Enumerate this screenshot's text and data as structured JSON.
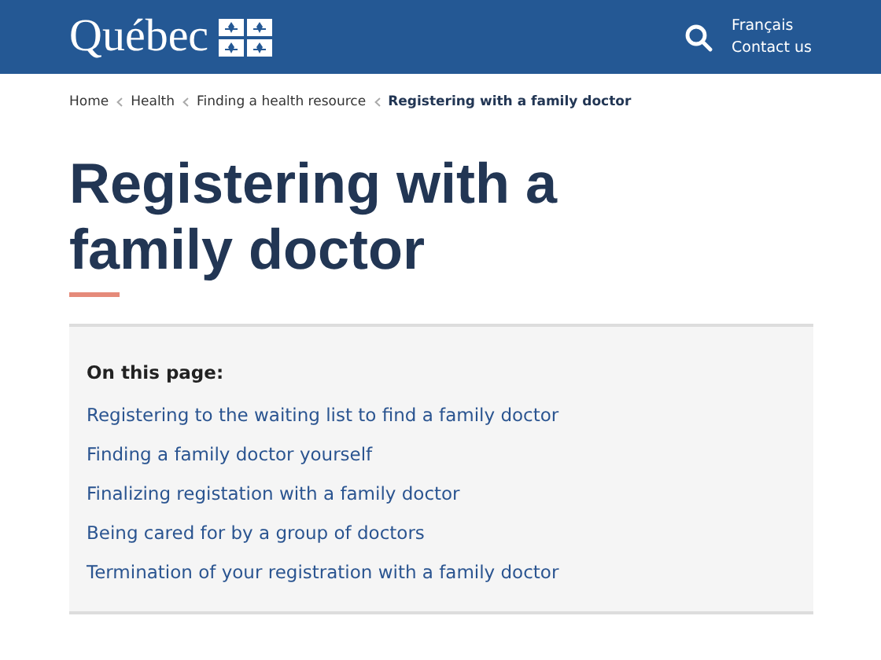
{
  "header": {
    "logo": "Québec",
    "links": [
      "Français",
      "Contact us"
    ]
  },
  "breadcrumb": [
    {
      "label": "Home",
      "current": false
    },
    {
      "label": "Health",
      "current": false
    },
    {
      "label": "Finding a health resource",
      "current": false
    },
    {
      "label": "Registering with a family doctor",
      "current": true
    }
  ],
  "title": "Registering with a family doctor",
  "toc": {
    "heading": "On this page:",
    "links": [
      "Registering to the waiting list to find a family doctor",
      "Finding a family doctor yourself",
      "Finalizing registation with a family doctor",
      "Being cared for by a group of doctors",
      "Termination of your registration with a family doctor"
    ]
  }
}
